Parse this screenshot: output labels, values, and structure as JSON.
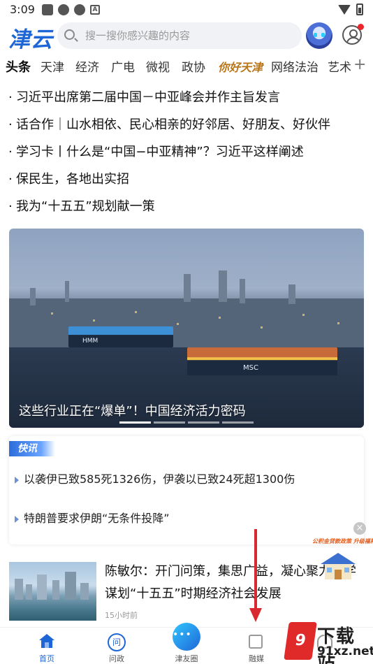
{
  "status_bar": {
    "time": "3:09",
    "notif_letter": "A"
  },
  "header": {
    "logo": "津云",
    "search_placeholder": "搜一搜你感兴趣的内容"
  },
  "tabs": [
    "头条",
    "天津",
    "经济",
    "广电",
    "微视",
    "政协",
    "你好天津",
    "网络法治",
    "艺术"
  ],
  "headlines": [
    "习近平出席第二届中国－中亚峰会并作主旨发言",
    "话合作｜山水相依、民心相亲的好邻居、好朋友、好伙伴",
    "学习卡丨什么是“中国−中亚精神”？习近平这样阐述",
    "保民生，各地出实招",
    "我为“十五五”规划献一策"
  ],
  "banner": {
    "caption": "这些行业正在“爆单”！中国经济活力密码",
    "ship_label_1": "HMM",
    "ship_label_2": "MSC"
  },
  "flash": {
    "tag": "快讯",
    "items": [
      "以袭伊已致585死1326伤，伊袭以已致24死超1300伤",
      "特朗普要求伊朗“无条件投降”"
    ]
  },
  "article": {
    "title": "陈敏尔：开门问策，集思广益，凝心聚力科学谋划“十五五”时期经济社会发展",
    "time": "15小时前"
  },
  "float_ad": {
    "text": "公积金贷款政策 升级福利"
  },
  "bottom_nav": [
    "首页",
    "问政",
    "津友圈",
    "融媒",
    ""
  ],
  "watermark": {
    "logo": "9",
    "title": "下载站",
    "sub": "91xz.net"
  },
  "colors": {
    "brand_blue": "#1e66d6",
    "alert_red": "#d9282f"
  }
}
